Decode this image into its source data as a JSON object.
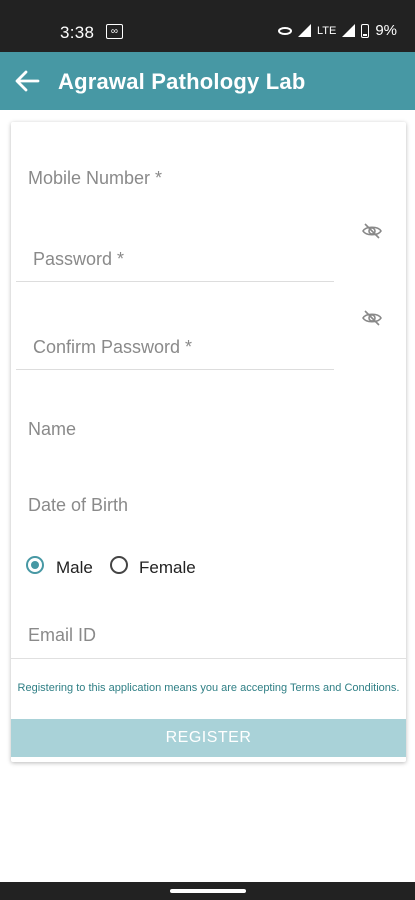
{
  "status_bar": {
    "time": "3:38",
    "infinity_badge": "∞",
    "lte": "LTE",
    "battery_pct": "9%"
  },
  "app_bar": {
    "back_icon": "arrow-left-icon",
    "title": "Agrawal Pathology Lab"
  },
  "form": {
    "mobile_placeholder": "Mobile Number *",
    "password_placeholder": "Password *",
    "confirm_password_placeholder": "Confirm Password *",
    "name_placeholder": "Name",
    "dob_placeholder": "Date of Birth",
    "gender": {
      "male_label": "Male",
      "female_label": "Female",
      "selected": "Male"
    },
    "email_placeholder": "Email ID",
    "terms_text": "Registering to this application means you are accepting Terms and Conditions.",
    "register_label": "REGISTER"
  },
  "colors": {
    "primary": "#4798a4",
    "button": "#a9d2d8",
    "terms_text": "#2f7f85"
  },
  "icons": {
    "password_toggle": "eye-off-icon",
    "confirm_password_toggle": "eye-off-icon"
  }
}
